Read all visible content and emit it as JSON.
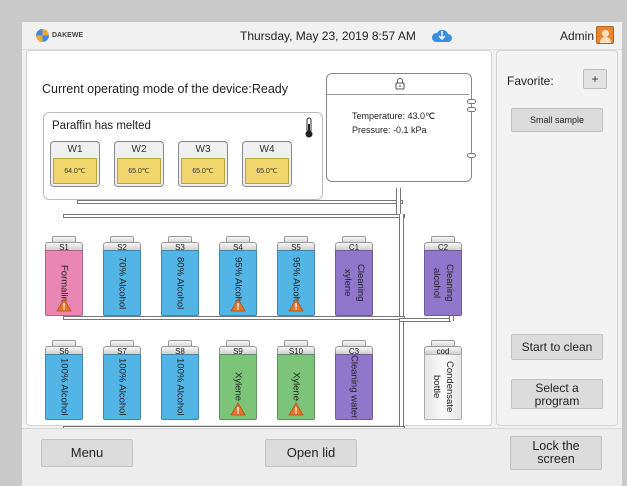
{
  "header": {
    "logo_text": "DAKEWE",
    "datetime": "Thursday, May 23, 2019  8:57 AM",
    "user": "Admin",
    "icons": [
      "cloud-icon",
      "avatar-icon"
    ]
  },
  "main": {
    "operating_mode": "Current operating mode of the device:Ready",
    "paraffin": {
      "label": "Paraffin has melted",
      "wax_baths": [
        {
          "name": "W1",
          "temp": "64.0℃"
        },
        {
          "name": "W2",
          "temp": "65.0℃"
        },
        {
          "name": "W3",
          "temp": "65.0℃"
        },
        {
          "name": "W4",
          "temp": "65.0℃"
        }
      ]
    },
    "retort": {
      "temperature": "Temperature:  43.0℃",
      "pressure": "Pressure:  -0.1 kPa"
    },
    "bottles_row1": [
      {
        "id": "S1",
        "reagent": "Formalin",
        "color": "#e986b3",
        "warning": true
      },
      {
        "id": "S2",
        "reagent": "70% Alcohol",
        "color": "#52b5e6",
        "warning": false
      },
      {
        "id": "S3",
        "reagent": "80% Alcohol",
        "color": "#52b5e6",
        "warning": false
      },
      {
        "id": "S4",
        "reagent": "95% Alcohol",
        "color": "#52b5e6",
        "warning": true
      },
      {
        "id": "S5",
        "reagent": "95% Alcohol",
        "color": "#52b5e6",
        "warning": true
      },
      {
        "id": "C1",
        "reagent": "Cleaning xylene",
        "color": "#9177cc",
        "warning": false
      },
      {
        "id": "C2",
        "reagent": "Cleaning alcohol",
        "color": "#9177cc",
        "warning": false
      }
    ],
    "bottles_row2": [
      {
        "id": "S6",
        "reagent": "100% Alcohol",
        "color": "#52b5e6",
        "warning": false
      },
      {
        "id": "S7",
        "reagent": "100% Alcohol",
        "color": "#52b5e6",
        "warning": false
      },
      {
        "id": "S8",
        "reagent": "100% Alcohol",
        "color": "#52b5e6",
        "warning": false
      },
      {
        "id": "S9",
        "reagent": "Xylene",
        "color": "#7cc47a",
        "warning": true
      },
      {
        "id": "S10",
        "reagent": "Xylene",
        "color": "#7cc47a",
        "warning": true
      },
      {
        "id": "C3",
        "reagent": "Cleaning water",
        "color": "#9177cc",
        "warning": false
      },
      {
        "id": "cod",
        "reagent": "Condensate bottle",
        "color": "#f2f2f2",
        "warning": false
      }
    ]
  },
  "sidebar": {
    "favorite_label": "Favorite:",
    "add_label": "+",
    "favorite_program": "Small sample",
    "start_clean": "Start to clean",
    "select_program_line1": "Select a",
    "select_program_line2": "program"
  },
  "footer": {
    "menu": "Menu",
    "open_lid": "Open lid",
    "lock_line1": "Lock the",
    "lock_line2": "screen"
  }
}
